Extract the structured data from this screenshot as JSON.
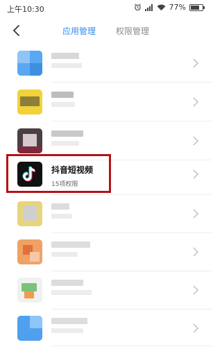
{
  "status_bar": {
    "time": "上午10:30",
    "battery_text": "77%",
    "battery_level": 0.77
  },
  "header": {
    "tabs": [
      {
        "label": "应用管理",
        "active": true
      },
      {
        "label": "权限管理",
        "active": false
      }
    ]
  },
  "highlighted_app": {
    "name": "抖音短视频",
    "subtitle": "15项权限"
  },
  "colors": {
    "accent_blue": "#2f8cf5",
    "highlight_red": "#b31217"
  }
}
